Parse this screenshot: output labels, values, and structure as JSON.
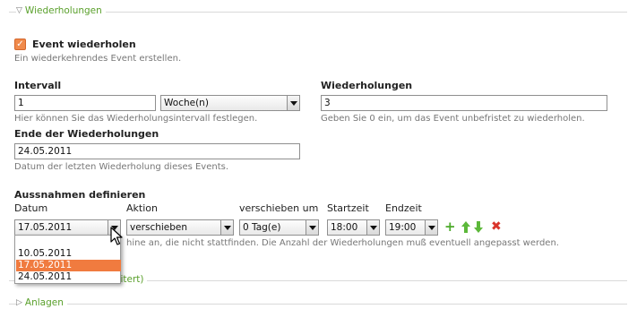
{
  "sections": {
    "repeats_title": "Wiederholungen",
    "attachments_title": "Anlagen",
    "hidden_section_tail": "eitert)"
  },
  "event_repeat": {
    "checkbox_label": "Event wiederholen",
    "checkbox_checked": true,
    "hint": "Ein wiederkehrendes Event erstellen."
  },
  "interval": {
    "label": "Intervall",
    "value": "1",
    "unit": "Woche(n)",
    "hint": "Hier können Sie das Wiederholungsintervall festlegen."
  },
  "repetitions": {
    "label": "Wiederholungen",
    "value": "3",
    "hint": "Geben Sie 0 ein, um das Event unbefristet zu wiederholen."
  },
  "end_date": {
    "label": "Ende der Wiederholungen",
    "value": "24.05.2011",
    "hint": "Datum der letzten Wiederholung dieses Events."
  },
  "exceptions": {
    "title": "Aussnahmen definieren",
    "columns": {
      "date": "Datum",
      "action": "Aktion",
      "shift": "verschieben um",
      "start": "Startzeit",
      "end": "Endzeit"
    },
    "row": {
      "date": "17.05.2011",
      "action": "verschieben",
      "shift": "0 Tag(e)",
      "start": "18:00",
      "end": "19:00"
    },
    "hint_partial": "hine an, die nicht stattfinden. Die Anzahl der Wiederholungen muß eventuell angepasst werden."
  },
  "date_dropdown": {
    "options": [
      "",
      "10.05.2011",
      "17.05.2011",
      "24.05.2011"
    ],
    "selected_index": 2
  },
  "colors": {
    "accent_green": "#5aa02c",
    "selection_orange": "#f07b3f",
    "checkbox_orange": "#f08a4b",
    "delete_red": "#d9342b"
  },
  "icons": [
    "plus-icon",
    "arrow-up-icon",
    "arrow-down-icon",
    "delete-icon",
    "mouse-cursor-icon"
  ]
}
